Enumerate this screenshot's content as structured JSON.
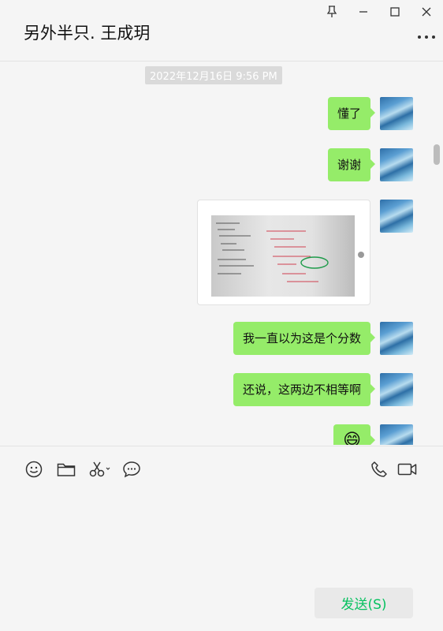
{
  "window": {
    "title": "另外半只. 王成玥",
    "controls": [
      "pin-icon",
      "minimize-icon",
      "maximize-icon",
      "close-icon"
    ]
  },
  "chat": {
    "timestamp": "2022年12月16日 9:56 PM",
    "messages": [
      {
        "type": "text",
        "text": "懂了"
      },
      {
        "type": "text",
        "text": "谢谢"
      },
      {
        "type": "image",
        "icon": "photo-thumbnail"
      },
      {
        "type": "text",
        "text": "我一直以为这是个分数"
      },
      {
        "type": "text",
        "text": "还说，这两边不相等啊"
      },
      {
        "type": "emoji",
        "text": "😄"
      }
    ]
  },
  "toolbar": {
    "icons": [
      "emoji-icon",
      "folder-icon",
      "scissors-icon",
      "chat-history-icon",
      "phone-icon",
      "video-call-icon"
    ]
  },
  "composer": {
    "input_value": "",
    "send_label": "发送(S)"
  },
  "colors": {
    "bubble": "#95ec69",
    "send_text": "#07c160",
    "background": "#f5f5f5"
  }
}
